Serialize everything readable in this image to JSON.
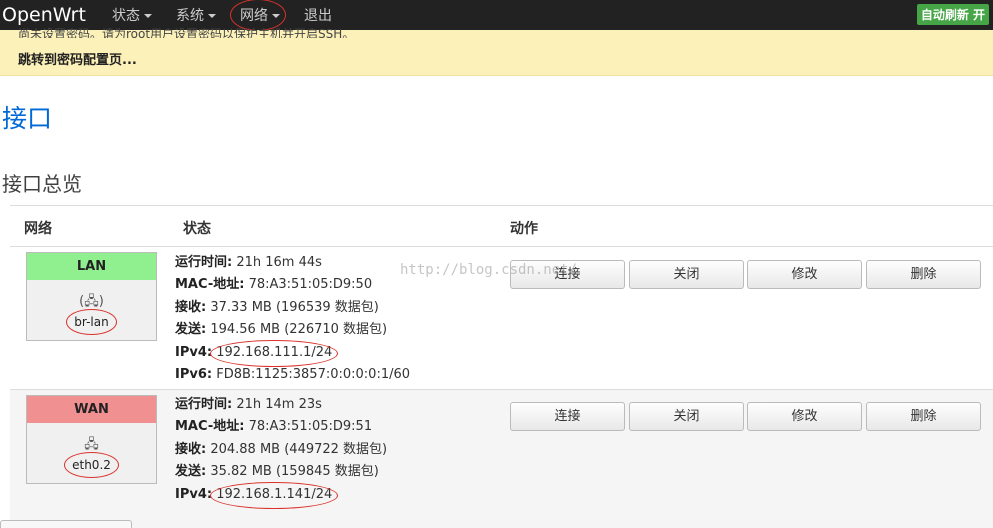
{
  "nav": {
    "brand": "OpenWrt",
    "items": [
      {
        "label": "状态"
      },
      {
        "label": "系统"
      },
      {
        "label": "网络"
      },
      {
        "label": "退出"
      }
    ],
    "autorefresh": "自动刷新 开"
  },
  "alert": {
    "cut_text": "尚未设置密码。请为root用户设置密码以保护主机并开启SSH。",
    "link": "跳转到密码配置页..."
  },
  "page_title": "接口",
  "section_title": "接口总览",
  "table": {
    "headers": [
      "网络",
      "状态",
      "动作"
    ],
    "rows": [
      {
        "name": "LAN",
        "device": "br-lan",
        "icons": "(🖧)",
        "uptime_label": "运行时间:",
        "uptime": "21h 16m 44s",
        "mac_label": "MAC-地址:",
        "mac": "78:A3:51:05:D9:50",
        "rx_label": "接收:",
        "rx": "37.33 MB (196539 数据包)",
        "tx_label": "发送:",
        "tx": "194.56 MB (226710 数据包)",
        "ipv4_label": "IPv4:",
        "ipv4": "192.168.111.1/24",
        "ipv6_label": "IPv6:",
        "ipv6": "FD8B:1125:3857:0:0:0:0:1/60"
      },
      {
        "name": "WAN",
        "device": "eth0.2",
        "icons": "🖧",
        "uptime_label": "运行时间:",
        "uptime": "21h 14m 23s",
        "mac_label": "MAC-地址:",
        "mac": "78:A3:51:05:D9:51",
        "rx_label": "接收:",
        "rx": "204.88 MB (449722 数据包)",
        "tx_label": "发送:",
        "tx": "35.82 MB (159845 数据包)",
        "ipv4_label": "IPv4:",
        "ipv4": "192.168.1.141/24"
      }
    ],
    "actions": [
      "连接",
      "关闭",
      "修改",
      "删除"
    ]
  },
  "watermark": "http://blog.csdn.net/",
  "colors": {
    "navbar": "#222222",
    "alert_bg": "#fcf1b8",
    "title": "#0069d6",
    "lan_header": "#90f090",
    "wan_header": "#f09090",
    "autorefresh": "#46a546",
    "annotation_circle": "#d9322a"
  }
}
